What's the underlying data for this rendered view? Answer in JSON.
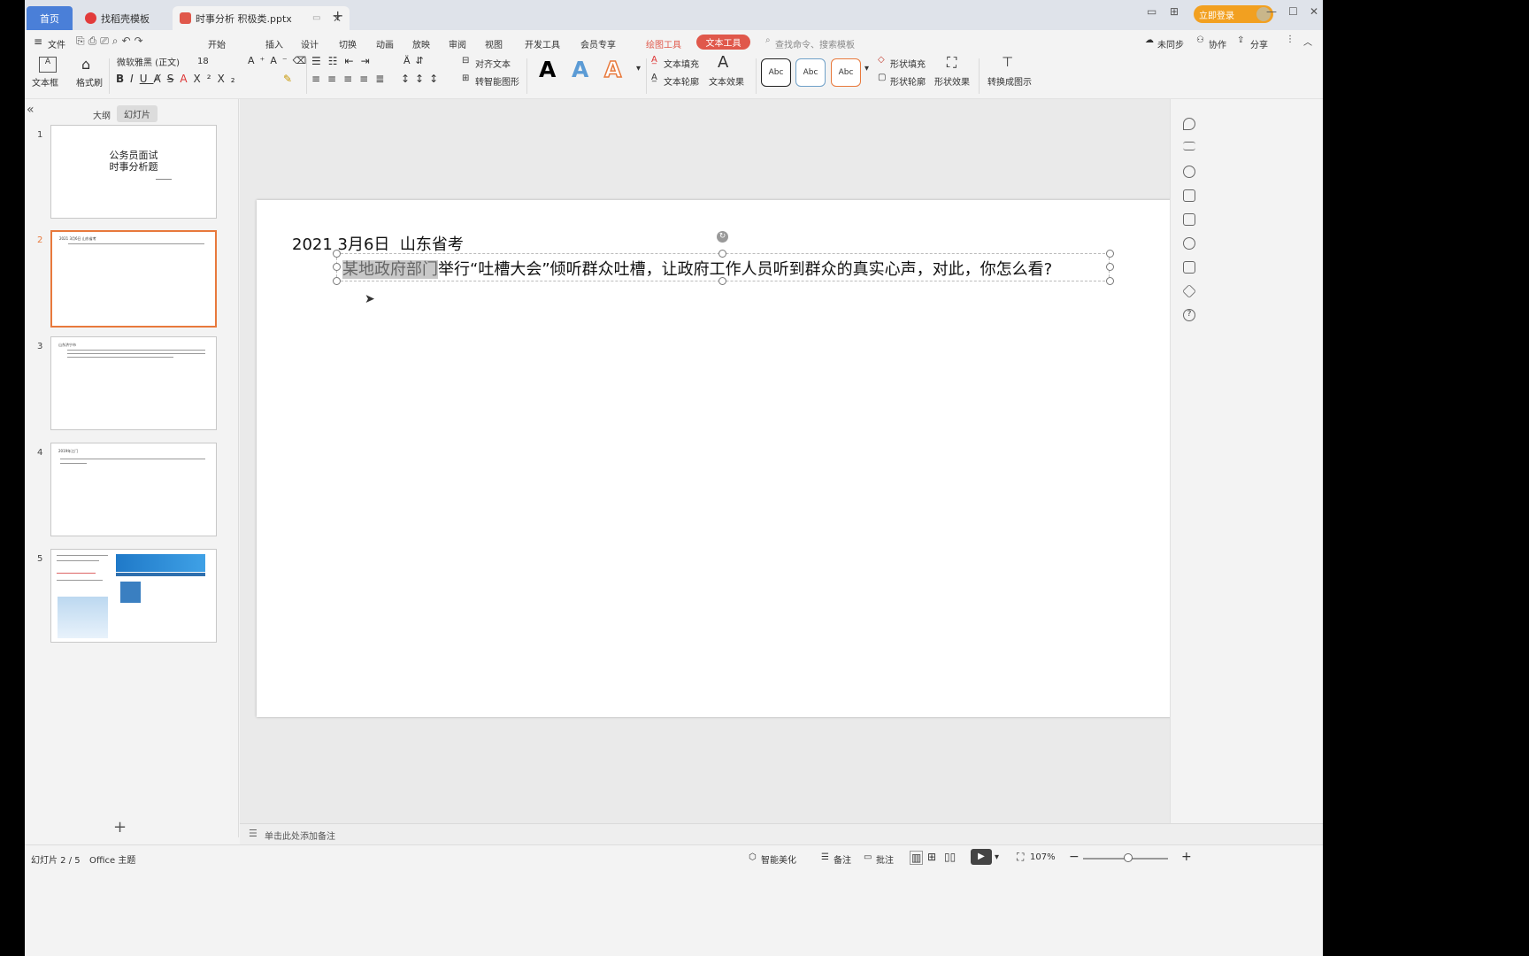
{
  "tabs": {
    "home": "首页",
    "template": "找稻壳模板",
    "document": "时事分析  积极类.pptx"
  },
  "titlebar": {
    "login": "立即登录"
  },
  "menu": {
    "file": "文件",
    "items": [
      "开始",
      "插入",
      "设计",
      "切换",
      "动画",
      "放映",
      "审阅",
      "视图",
      "开发工具",
      "会员专享"
    ],
    "drawing_tools": "绘图工具",
    "text_tools": "文本工具",
    "search_placeholder": "查找命令、搜索模板",
    "unsynced": "未同步",
    "collab": "协作",
    "share": "分享"
  },
  "ribbon": {
    "textbox": "文本框",
    "format_painter": "格式刷",
    "font_name": "微软雅黑 (正文)",
    "font_size": "18",
    "align_text": "对齐文本",
    "smart_shape": "转智能图形",
    "text_fill": "文本填充",
    "text_outline": "文本轮廓",
    "text_effect": "文本效果",
    "shape_fill": "形状填充",
    "shape_outline": "形状轮廓",
    "shape_effect": "形状效果",
    "convert_graphic": "转换成图示",
    "style_sample": "Abc",
    "wordart_sample": "A"
  },
  "left_panel": {
    "outline_tab": "大纲",
    "slides_tab": "幻灯片",
    "add_label": "+",
    "slides": [
      {
        "num": "1",
        "title": "公务员面试",
        "subtitle": "时事分析题"
      },
      {
        "num": "2",
        "title": "2021 3月6日 山东省考"
      },
      {
        "num": "3",
        "title": "山东济宁市"
      },
      {
        "num": "4",
        "title": "2019年江门"
      },
      {
        "num": "5",
        "title": ""
      }
    ]
  },
  "slide": {
    "date_line": "2021 3月6日  山东省考",
    "question_highlight": "某地政府部门",
    "question_rest": "举行“吐槽大会”倾听群众吐槽，让政府工作人员听到群众的真实心声，对此，你怎么看?"
  },
  "notes": {
    "placeholder": "单击此处添加备注"
  },
  "status": {
    "slide_counter": "幻灯片 2 / 5",
    "theme": "Office 主题",
    "beautify": "智能美化",
    "notes": "备注",
    "comments": "批注",
    "zoom": "107%"
  },
  "colors": {
    "accent": "#e0584b",
    "tab_home": "#4a7fd8",
    "selection": "#e8793c",
    "login": "#f2a020"
  }
}
